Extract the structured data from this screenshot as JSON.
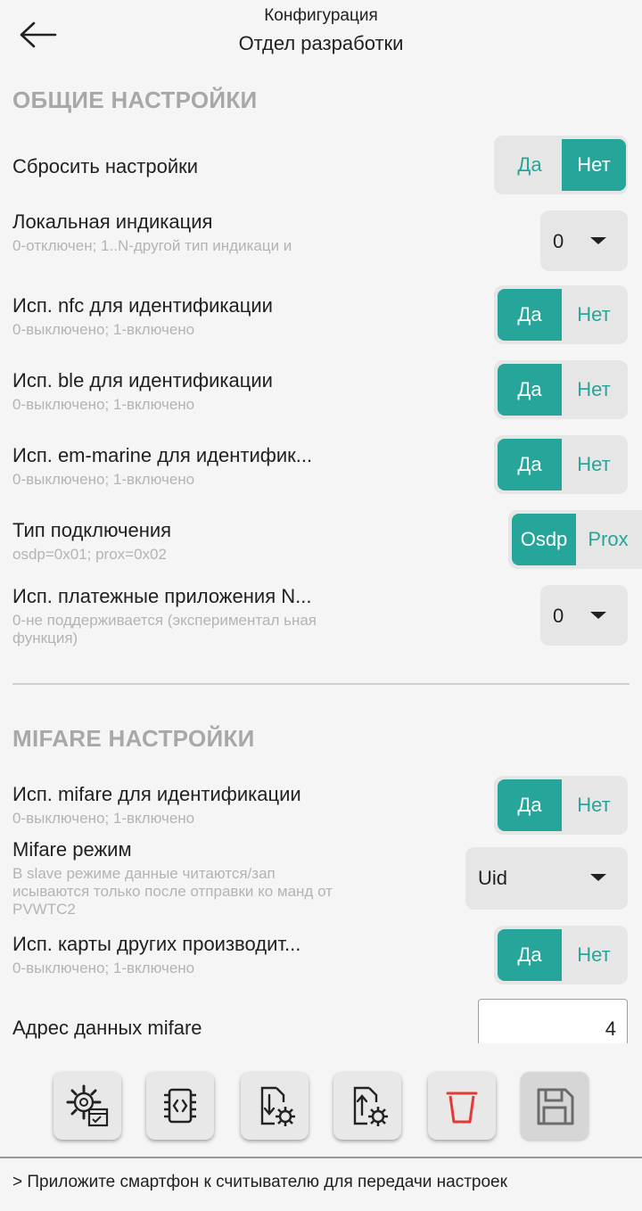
{
  "header": {
    "subtitle": "Конфигурация",
    "title": "Отдел разработки"
  },
  "general": {
    "section_title": "ОБЩИЕ НАСТРОЙКИ",
    "reset": {
      "label": "Сбросить настройки",
      "yes": "Да",
      "no": "Нет",
      "selected": "Нет"
    },
    "local_indication": {
      "label": "Локальная индикация",
      "desc": "0-отключен; 1..N-другой тип индикаци и",
      "value": "0"
    },
    "nfc": {
      "label": "Исп. nfc для идентификации",
      "desc": "0-выключено; 1-включено",
      "yes": "Да",
      "no": "Нет",
      "selected": "Да"
    },
    "ble": {
      "label": "Исп. ble для идентификации",
      "desc": "0-выключено; 1-включено",
      "yes": "Да",
      "no": "Нет",
      "selected": "Да"
    },
    "em_marine": {
      "label": "Исп. em-marine для идентифик...",
      "desc": "0-выключено; 1-включено",
      "yes": "Да",
      "no": "Нет",
      "selected": "Да"
    },
    "connection_type": {
      "label": "Тип подключения",
      "desc": "osdp=0x01; prox=0x02",
      "left": "Osdp",
      "right": "Prox",
      "selected": "Osdp"
    },
    "payment_apps": {
      "label": "Исп. платежные приложения N...",
      "desc": "0-не поддерживается (экспериментавль ная функция)",
      "value": "0"
    }
  },
  "mifare": {
    "section_title": "MIFARE НАСТРОЙКИ",
    "use_mifare": {
      "label": "Исп. mifare для идентификации",
      "desc": "0-выключено; 1-включено",
      "yes": "Да",
      "no": "Нет",
      "selected": "Да"
    },
    "mode": {
      "label": "Mifare режим",
      "desc": "В slave режиме данные читаются/зап исываются только после отправки ко манд от PVWTC2",
      "value": "Uid"
    },
    "other_cards": {
      "label": "Исп. карты других производит...",
      "desc": "0-выключено; 1-включено",
      "yes": "Да",
      "no": "Нет",
      "selected": "Да"
    },
    "data_address": {
      "label": "Адрес данных mifare",
      "value": "4"
    }
  },
  "toolbar": {
    "icons": [
      "settings-config-icon",
      "firmware-chip-icon",
      "download-settings-icon",
      "upload-settings-icon",
      "delete-icon",
      "save-icon"
    ],
    "accent": "#26a69a",
    "danger": "#e53935"
  },
  "status": {
    "text": "> Приложите смартфон к считывателю для передачи настроек"
  }
}
